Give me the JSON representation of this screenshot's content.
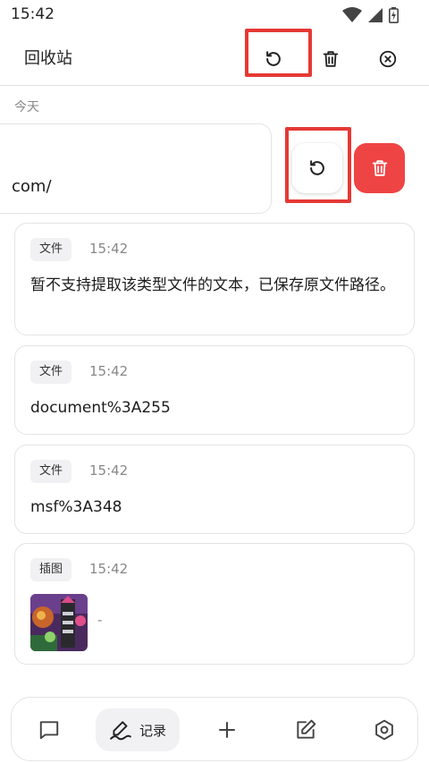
{
  "status_bar": {
    "time": "15:42",
    "icons": [
      "wifi-icon",
      "signal-icon",
      "battery-icon"
    ]
  },
  "app_bar": {
    "title": "回收站",
    "actions": [
      "restore-all-icon",
      "delete-all-icon",
      "close-icon"
    ]
  },
  "section_label": "今天",
  "swiped_item": {
    "text": "com/",
    "actions": [
      "restore-icon",
      "delete-icon"
    ]
  },
  "items": [
    {
      "tag": "文件",
      "time": "15:42",
      "text": "暂不支持提取该类型文件的文本，已保存原文件路径。"
    },
    {
      "tag": "文件",
      "time": "15:42",
      "text": "document%3A255"
    },
    {
      "tag": "文件",
      "time": "15:42",
      "text": "msf%3A348"
    },
    {
      "tag": "插图",
      "time": "15:42",
      "caption": "-"
    }
  ],
  "bottom_nav": {
    "items": [
      {
        "icon": "chat-icon",
        "label": ""
      },
      {
        "icon": "handwriting-icon",
        "label": "记录",
        "active": true
      },
      {
        "icon": "plus-icon",
        "label": ""
      },
      {
        "icon": "edit-icon",
        "label": ""
      },
      {
        "icon": "gear-icon",
        "label": ""
      }
    ]
  },
  "colors": {
    "highlight": "#e53935",
    "delete": "#ef4444",
    "tag_bg": "#f1f1f3",
    "border": "#e4e4e4"
  }
}
